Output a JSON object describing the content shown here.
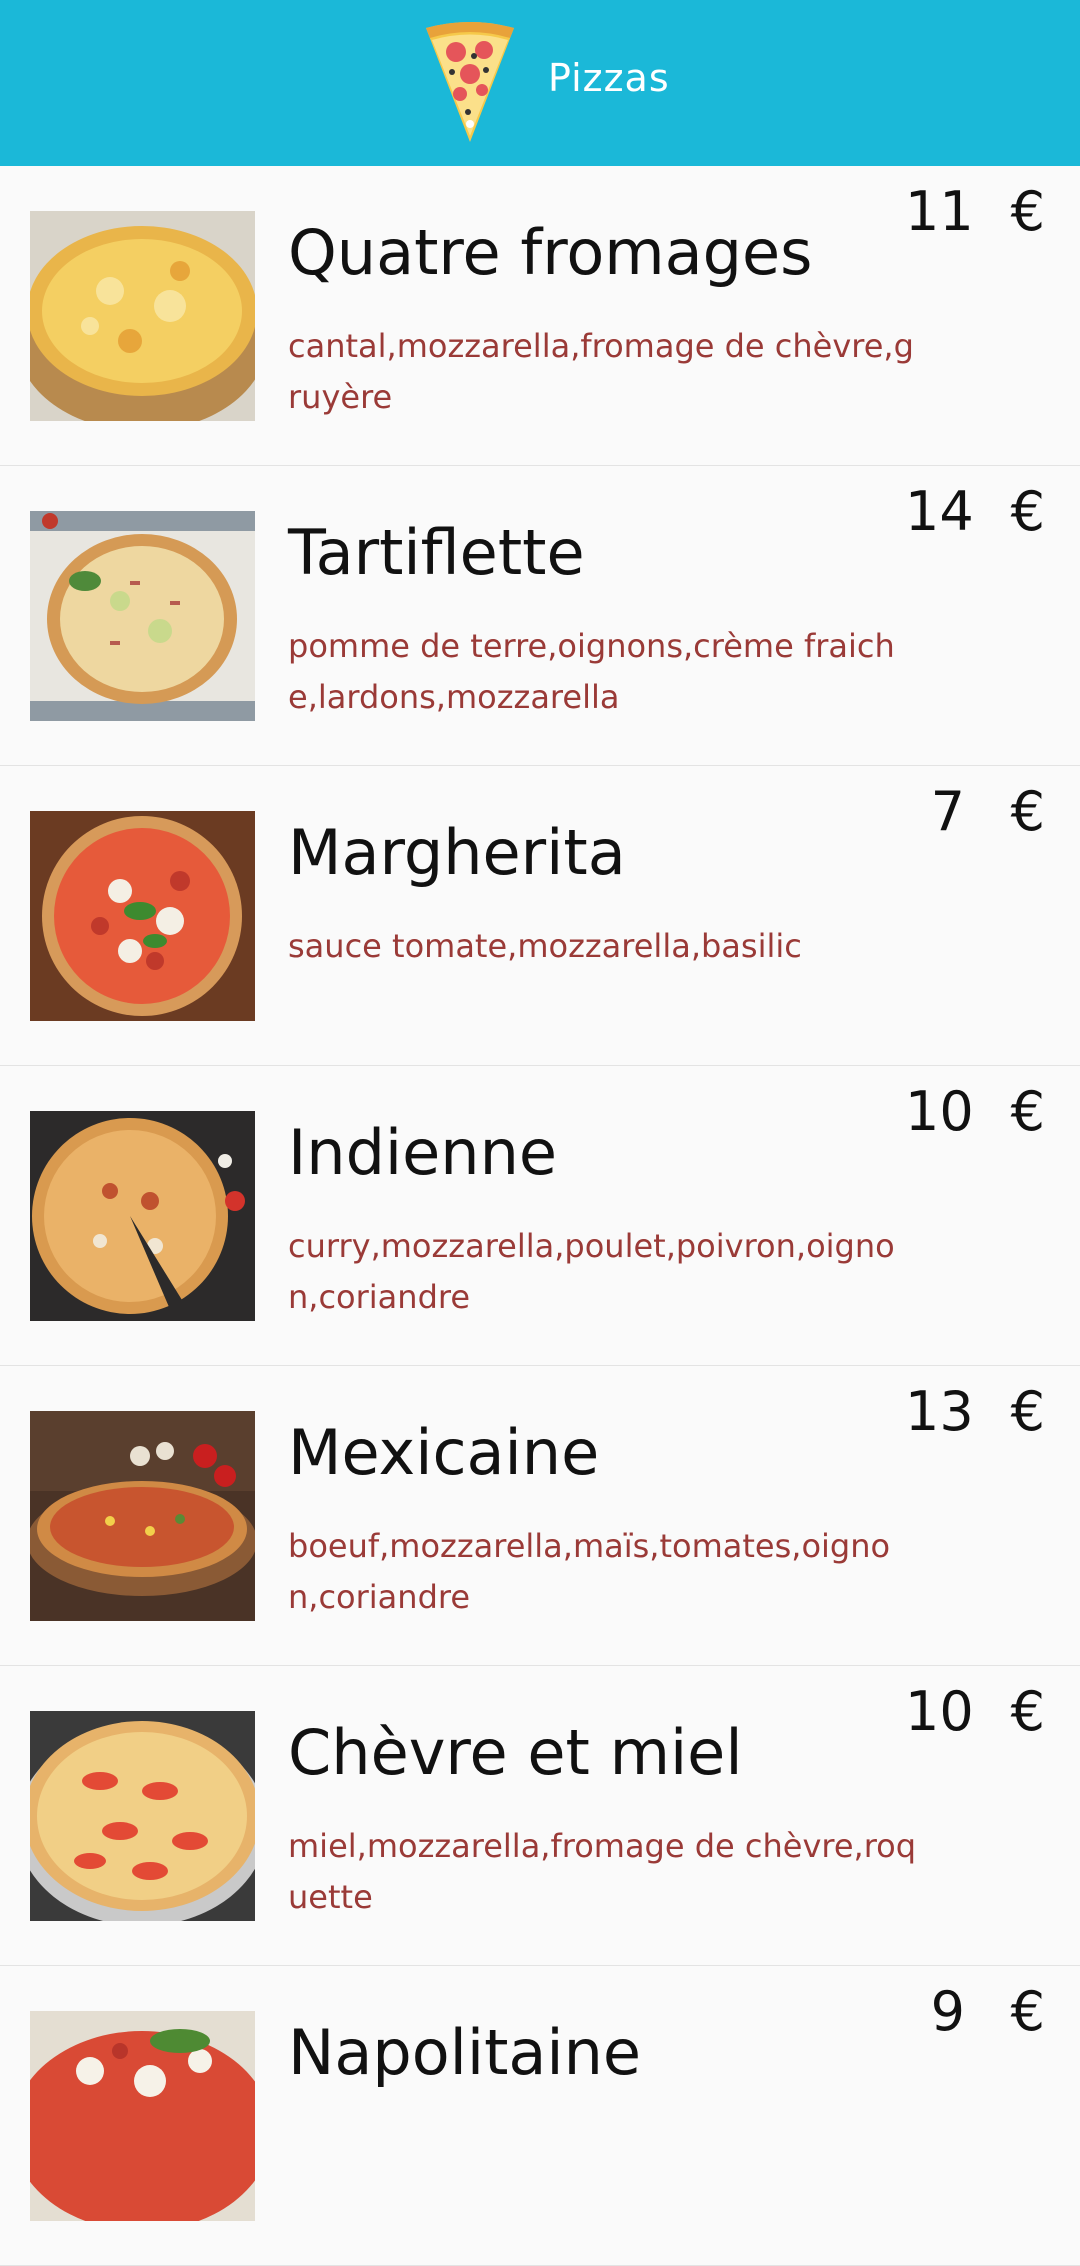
{
  "appbar": {
    "title": "Pizzas",
    "logo_icon": "pizza-slice-icon",
    "color": "#1bb8d8"
  },
  "colors": {
    "ingredients": "#9a3a37",
    "name": "#111111",
    "background": "#fafafa"
  },
  "pizzas": [
    {
      "name": "Quatre fromages",
      "ingredients": "cantal,mozzarella,fromage de chèvre,gruyère",
      "price": "11",
      "currency": "€",
      "image": "four-cheese-pizza-photo"
    },
    {
      "name": "Tartiflette",
      "ingredients": "pomme de terre,oignons,crème fraiche,lardons,mozzarella",
      "price": "14",
      "currency": "€",
      "image": "tartiflette-pizza-photo"
    },
    {
      "name": "Margherita",
      "ingredients": "sauce tomate,mozzarella,basilic",
      "price": "7",
      "currency": "€",
      "image": "margherita-pizza-photo"
    },
    {
      "name": "Indienne",
      "ingredients": "curry,mozzarella,poulet,poivron,oignon,coriandre",
      "price": "10",
      "currency": "€",
      "image": "indian-pizza-photo"
    },
    {
      "name": "Mexicaine",
      "ingredients": "boeuf,mozzarella,maïs,tomates,oignon,coriandre",
      "price": "13",
      "currency": "€",
      "image": "mexican-pizza-photo"
    },
    {
      "name": "Chèvre et miel",
      "ingredients": "miel,mozzarella,fromage de chèvre,roquette",
      "price": "10",
      "currency": "€",
      "image": "goat-cheese-honey-pizza-photo"
    },
    {
      "name": "Napolitaine",
      "ingredients": "",
      "price": "9",
      "currency": "€",
      "image": "napolitaine-pizza-photo"
    }
  ]
}
